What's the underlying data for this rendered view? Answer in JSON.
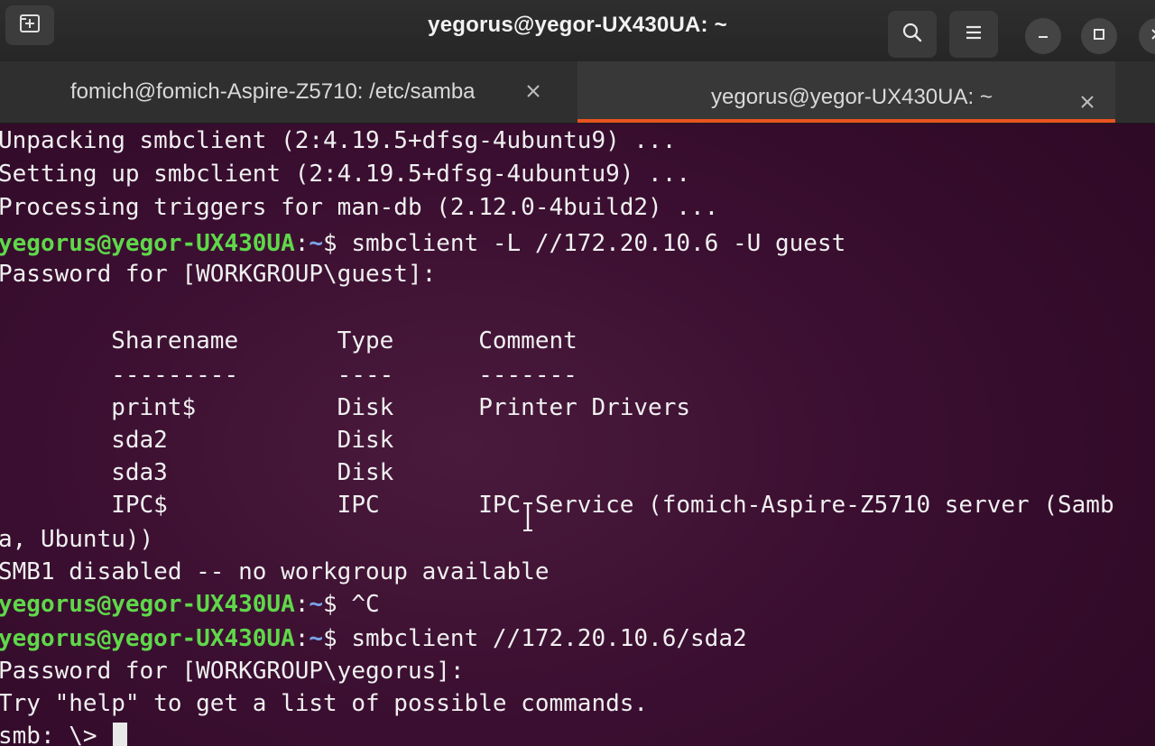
{
  "window": {
    "title": "yegorus@yegor-UX430UA: ~"
  },
  "tabs": [
    {
      "label": "fomich@fomich-Aspire-Z5710: /etc/samba",
      "active": false
    },
    {
      "label": "yegorus@yegor-UX430UA: ~",
      "active": true
    }
  ],
  "icons": {
    "new_tab": "new-tab-icon",
    "search": "search-icon",
    "menu": "hamburger-menu-icon",
    "minimize": "minimize-icon",
    "maximize": "maximize-icon",
    "close": "close-icon"
  },
  "colors": {
    "accent": "#e95420",
    "prompt_user": "#5fd84a",
    "prompt_path": "#7aa4e8",
    "terminal_bg": "#3a0e30"
  },
  "terminal": {
    "lines": [
      {
        "text": "Unpacking smbclient (2:4.19.5+dfsg-4ubuntu9) ..."
      },
      {
        "text": "Setting up smbclient (2:4.19.5+dfsg-4ubuntu9) ..."
      },
      {
        "text": "Processing triggers for man-db (2.12.0-4build2) ..."
      },
      {
        "prompt_user": "yegorus@yegor-UX430UA",
        "prompt_colon": ":",
        "prompt_path": "~",
        "text": "$ smbclient -L //172.20.10.6 -U guest"
      },
      {
        "text": "Password for [WORKGROUP\\guest]:"
      },
      {
        "text": ""
      },
      {
        "text": "        Sharename       Type      Comment"
      },
      {
        "text": "        ---------       ----      -------"
      },
      {
        "text": "        print$          Disk      Printer Drivers"
      },
      {
        "text": "        sda2            Disk      "
      },
      {
        "text": "        sda3            Disk      "
      },
      {
        "text": "        IPC$            IPC       IPC Service (fomich-Aspire-Z5710 server (Samb"
      },
      {
        "text": "a, Ubuntu))"
      },
      {
        "text": "SMB1 disabled -- no workgroup available"
      },
      {
        "prompt_user": "yegorus@yegor-UX430UA",
        "prompt_colon": ":",
        "prompt_path": "~",
        "text": "$ ^C"
      },
      {
        "prompt_user": "yegorus@yegor-UX430UA",
        "prompt_colon": ":",
        "prompt_path": "~",
        "text": "$ smbclient //172.20.10.6/sda2"
      },
      {
        "text": "Password for [WORKGROUP\\yegorus]:"
      },
      {
        "text": "Try \"help\" to get a list of possible commands."
      },
      {
        "text": "smb: \\> ",
        "cursor": true
      }
    ]
  }
}
